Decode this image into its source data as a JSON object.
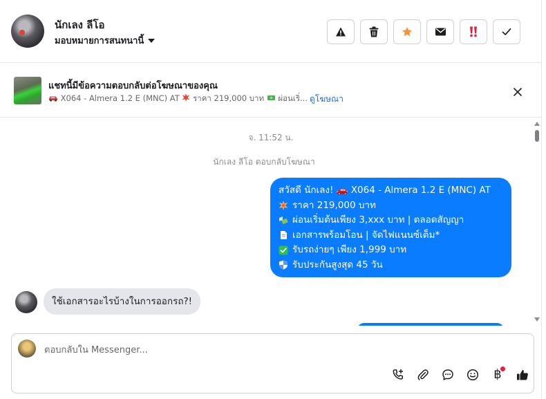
{
  "header": {
    "contact_name": "นักเลง ลีโอ",
    "assign_label": "มอบหมายการสนทนานี้",
    "actions": [
      {
        "name": "report-button",
        "icon": "warning-icon"
      },
      {
        "name": "delete-button",
        "icon": "trash-icon"
      },
      {
        "name": "star-button",
        "icon": "star-icon",
        "color": "#f7923b"
      },
      {
        "name": "mark-unread-button",
        "icon": "envelope-icon"
      },
      {
        "name": "follow-up-button",
        "icon": "double-exclamation-icon",
        "color": "#e41e3f"
      },
      {
        "name": "mark-done-button",
        "icon": "checkmark-icon"
      }
    ]
  },
  "ad_banner": {
    "title": "แชทนี้มีข้อความตอบกลับต่อโฆษณาของคุณ",
    "ad_text": "X064 - Almera 1.2 E (MNC) AT",
    "ad_price": "ราคา 219,000 บาท",
    "ad_more": "ผ่อนเริ่...",
    "view_ad_link": "ดูโฆษณา"
  },
  "chat": {
    "timestamp": "จ. 11:52 น.",
    "reply_note": "นักเลง ลีโอ ตอบกลับโฆษณา",
    "outgoing_lines": [
      "สวัสดี นักเลง! 🚗 X064 - Almera 1.2 E (MNC) AT",
      "ราคา 219,000 บาท",
      "ผ่อนเริ่มต้นเพียง 3,xxx บาท | ตลอดสัญญา",
      "เอกสารพร้อมโอน | จัดไฟแนนซ์เต็ม*",
      "รับรถง่ายๆ เพียง 1,999 บาท",
      "รับประกันสูงสุด 45 วัน"
    ],
    "incoming_message": "ใช้เอกสารอะไรบ้างในการออกรถ?!"
  },
  "composer": {
    "placeholder": "ตอบกลับใน Messenger...",
    "value": "",
    "tools": [
      "call-plus-icon",
      "paperclip-icon",
      "saved-reply-icon",
      "emoji-icon",
      "baht-icon",
      "thumbs-up-icon"
    ],
    "baht_symbol": "฿"
  },
  "colors": {
    "accent": "#0a7cff",
    "link": "#216fdb",
    "star": "#f7923b",
    "alert": "#e41e3f"
  }
}
